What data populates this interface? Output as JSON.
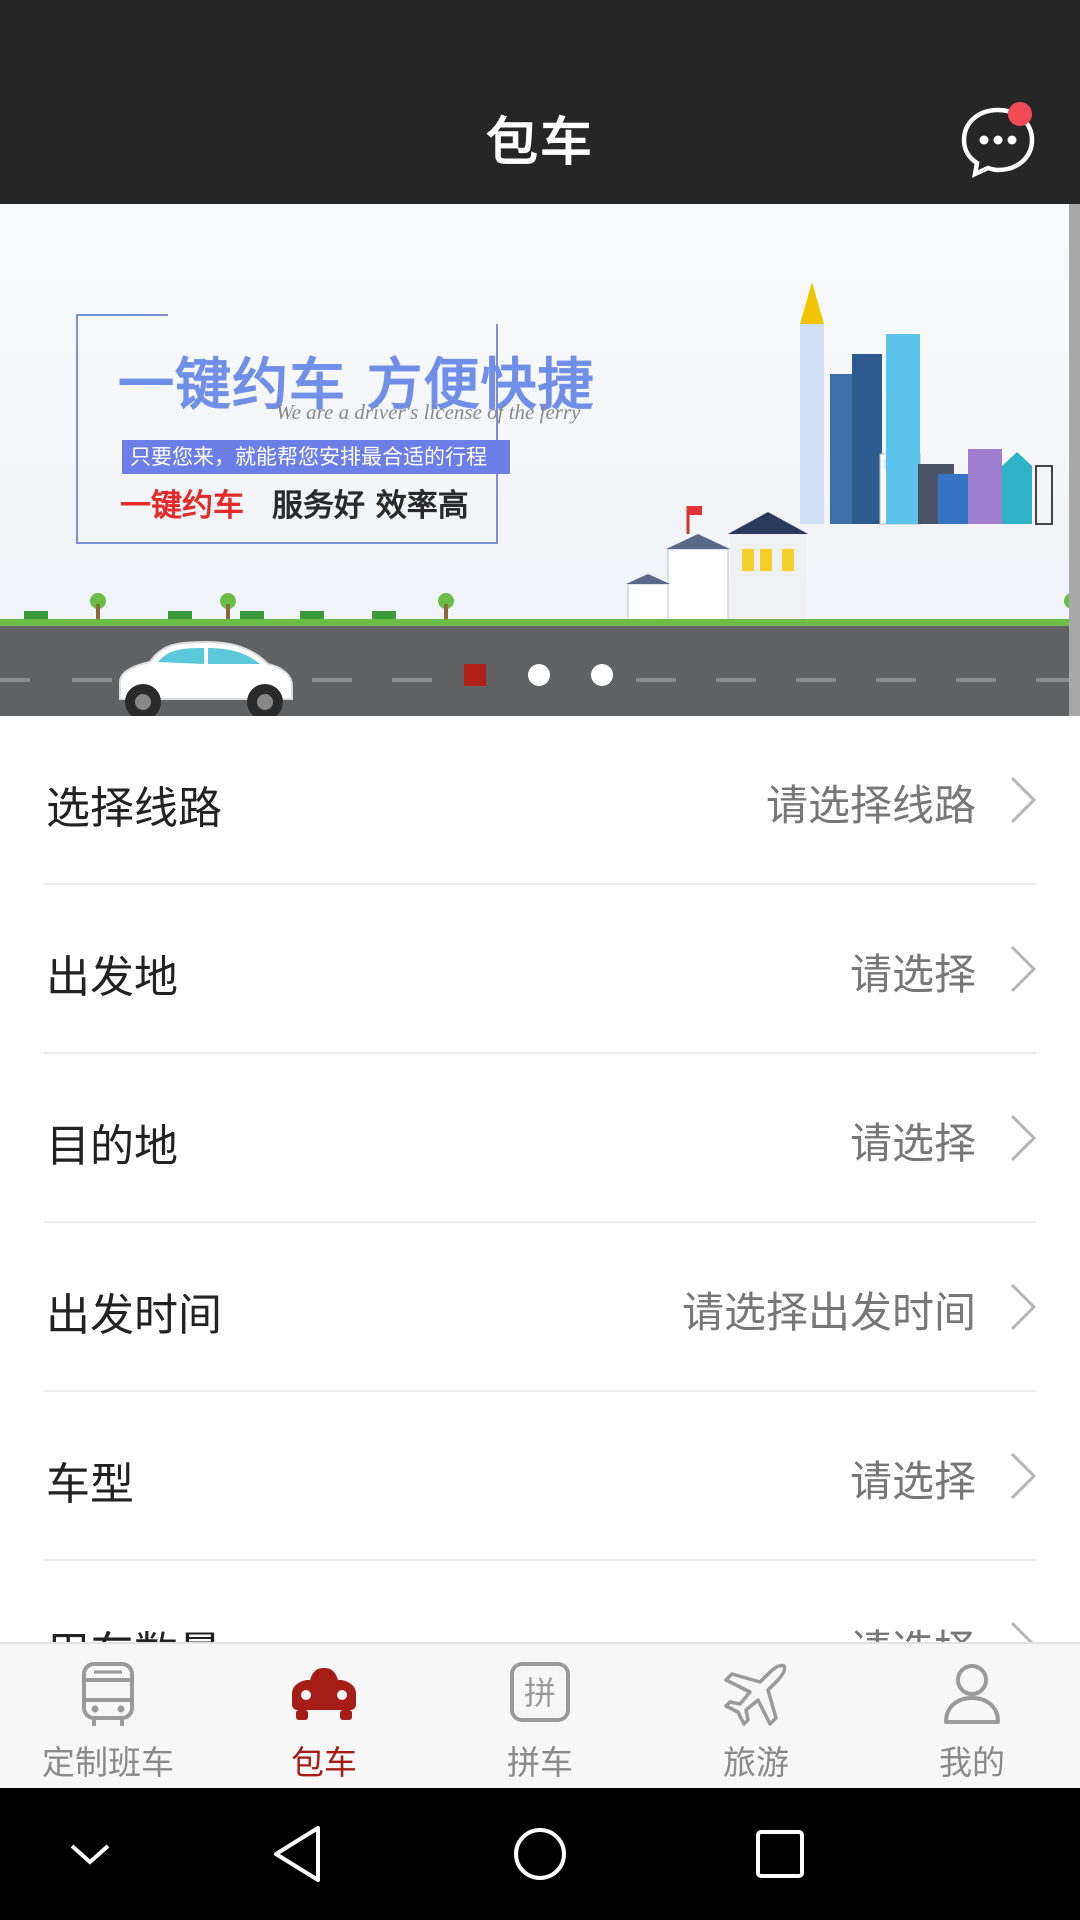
{
  "header": {
    "title": "包车",
    "message_icon": "chat-bubble-icon",
    "has_unread": true,
    "badge_color": "#f24a54"
  },
  "banner": {
    "headline": "一键约车 方便快捷",
    "subtitle_en": "We are a driver's license of the ferry",
    "tagline": "只要您来，就能帮您安排最合适的行程",
    "slogan_red": "一键约车",
    "slogan_black": "服务好 效率高",
    "slides_count": 3,
    "active_slide": 1
  },
  "form": {
    "rows": [
      {
        "label": "选择线路",
        "value": "请选择线路"
      },
      {
        "label": "出发地",
        "value": "请选择"
      },
      {
        "label": "目的地",
        "value": "请选择"
      },
      {
        "label": "出发时间",
        "value": "请选择出发时间"
      },
      {
        "label": "车型",
        "value": "请选择"
      },
      {
        "label": "用车数量",
        "value": "请选择"
      }
    ]
  },
  "tabbar": {
    "active_color": "#a51d16",
    "tabs": [
      {
        "label": "定制班车",
        "icon": "bus-icon"
      },
      {
        "label": "包车",
        "icon": "car-icon",
        "active": true
      },
      {
        "label": "拼车",
        "icon": "carpool-icon"
      },
      {
        "label": "旅游",
        "icon": "airplane-icon"
      },
      {
        "label": "我的",
        "icon": "user-icon"
      }
    ]
  },
  "system_nav": {
    "buttons": [
      "collapse-icon",
      "back-icon",
      "home-icon",
      "recents-icon"
    ]
  }
}
